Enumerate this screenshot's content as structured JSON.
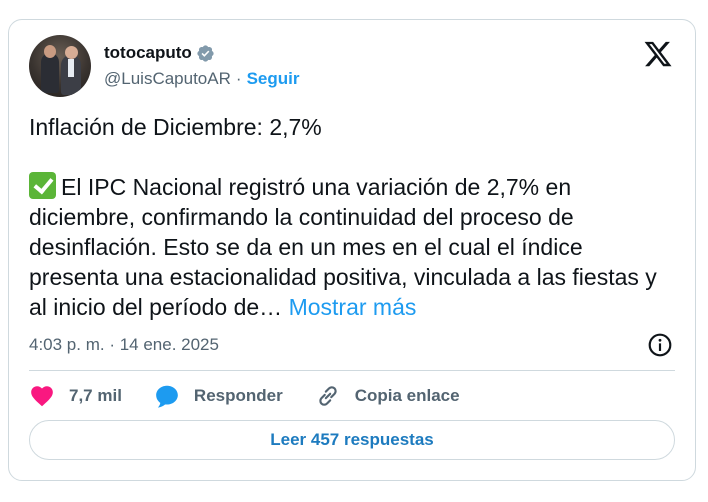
{
  "author": {
    "name": "totocaputo",
    "handle": "@LuisCaputoAR",
    "separator": "·",
    "follow_label": "Seguir"
  },
  "tweet": {
    "line1": "Inflación de Diciembre: 2,7%",
    "body": "El IPC Nacional registró una variación de 2,7% en diciembre, confirmando la continuidad del proceso de desinflación. Esto se da en un mes en el cual el índice presenta una estacionalidad positiva, vinculada a las fiestas y al inicio del período de… ",
    "show_more": "Mostrar más",
    "timestamp": "4:03 p. m. · 14 ene. 2025"
  },
  "actions": {
    "likes": "7,7 mil",
    "reply_label": "Responder",
    "copy_label": "Copia enlace"
  },
  "replies_button": "Leer 457 respuestas",
  "colors": {
    "accent": "#1d9bf0",
    "heart": "#f91880",
    "muted": "#536471",
    "check": "#5bb538"
  }
}
